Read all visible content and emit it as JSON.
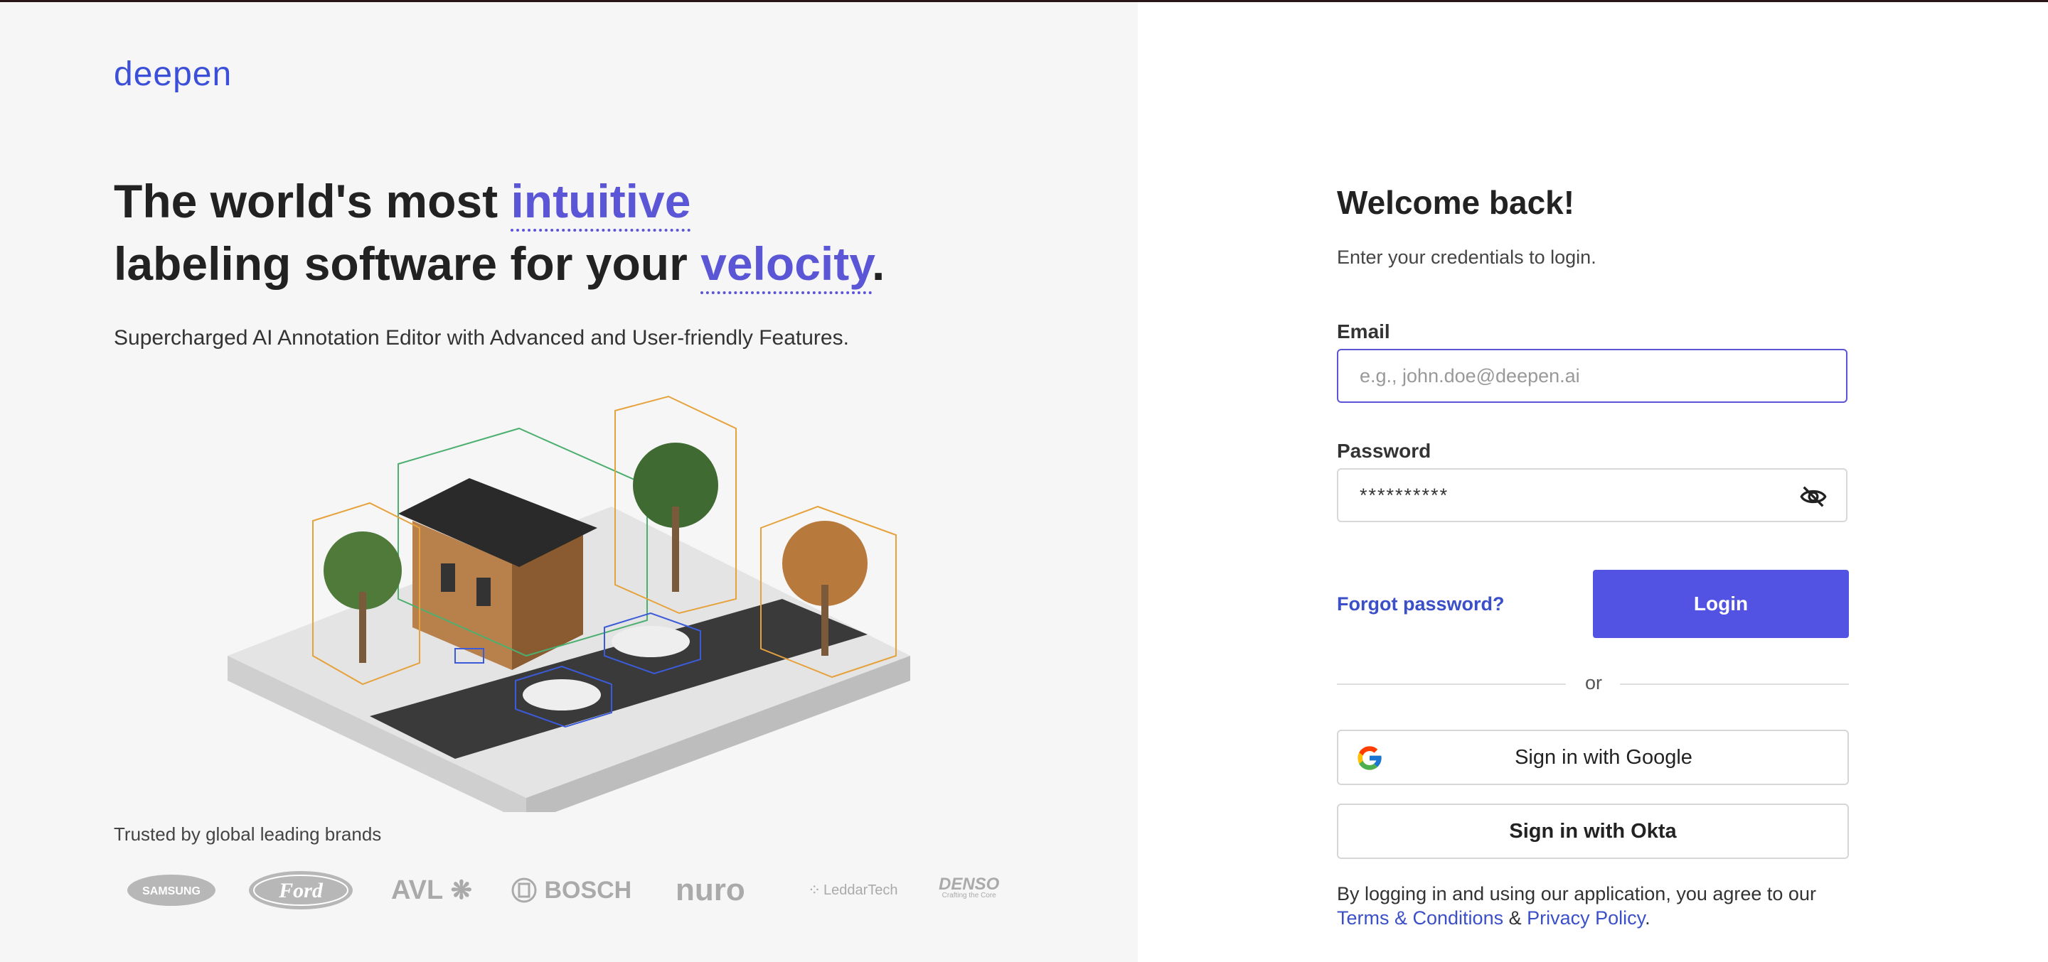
{
  "brand": {
    "logo_text": "deepen",
    "color": "#3b4fd8"
  },
  "hero": {
    "headline_part1": "The world's most ",
    "headline_highlight1": "intuitive",
    "headline_part2": "labeling software for your ",
    "headline_highlight2": "velocity",
    "headline_end": ".",
    "subtitle": "Supercharged AI Annotation Editor with Advanced and User-friendly Features.",
    "trusted_label": "Trusted by global leading brands",
    "brands": [
      "SAMSUNG",
      "Ford",
      "AVL",
      "BOSCH",
      "nuro",
      "LeddarTech",
      "DENSO",
      "Crafting the Core"
    ]
  },
  "login": {
    "title": "Welcome back!",
    "instructions": "Enter your credentials to login.",
    "email_label": "Email",
    "email_placeholder": "e.g., john.doe@deepen.ai",
    "password_label": "Password",
    "password_value": "**********",
    "forgot_password": "Forgot password?",
    "login_button": "Login",
    "or_text": "or",
    "google_button": "Sign in with Google",
    "okta_button": "Sign in with Okta",
    "agree_text": "By logging in and using our application, you agree to our ",
    "terms_link": "Terms & Conditions",
    "amp": " & ",
    "privacy_link": "Privacy Policy",
    "period": "."
  },
  "icons": {
    "password_toggle": "eye-off-icon",
    "google": "google-icon"
  },
  "colors": {
    "accent": "#5252e3",
    "highlight": "#5b56d6",
    "link": "#3b4fc8",
    "left_panel_bg": "#f6f6f6",
    "bbox_orange": "#e6a23c",
    "bbox_green": "#4caf70",
    "bbox_blue": "#3b5bd8"
  }
}
